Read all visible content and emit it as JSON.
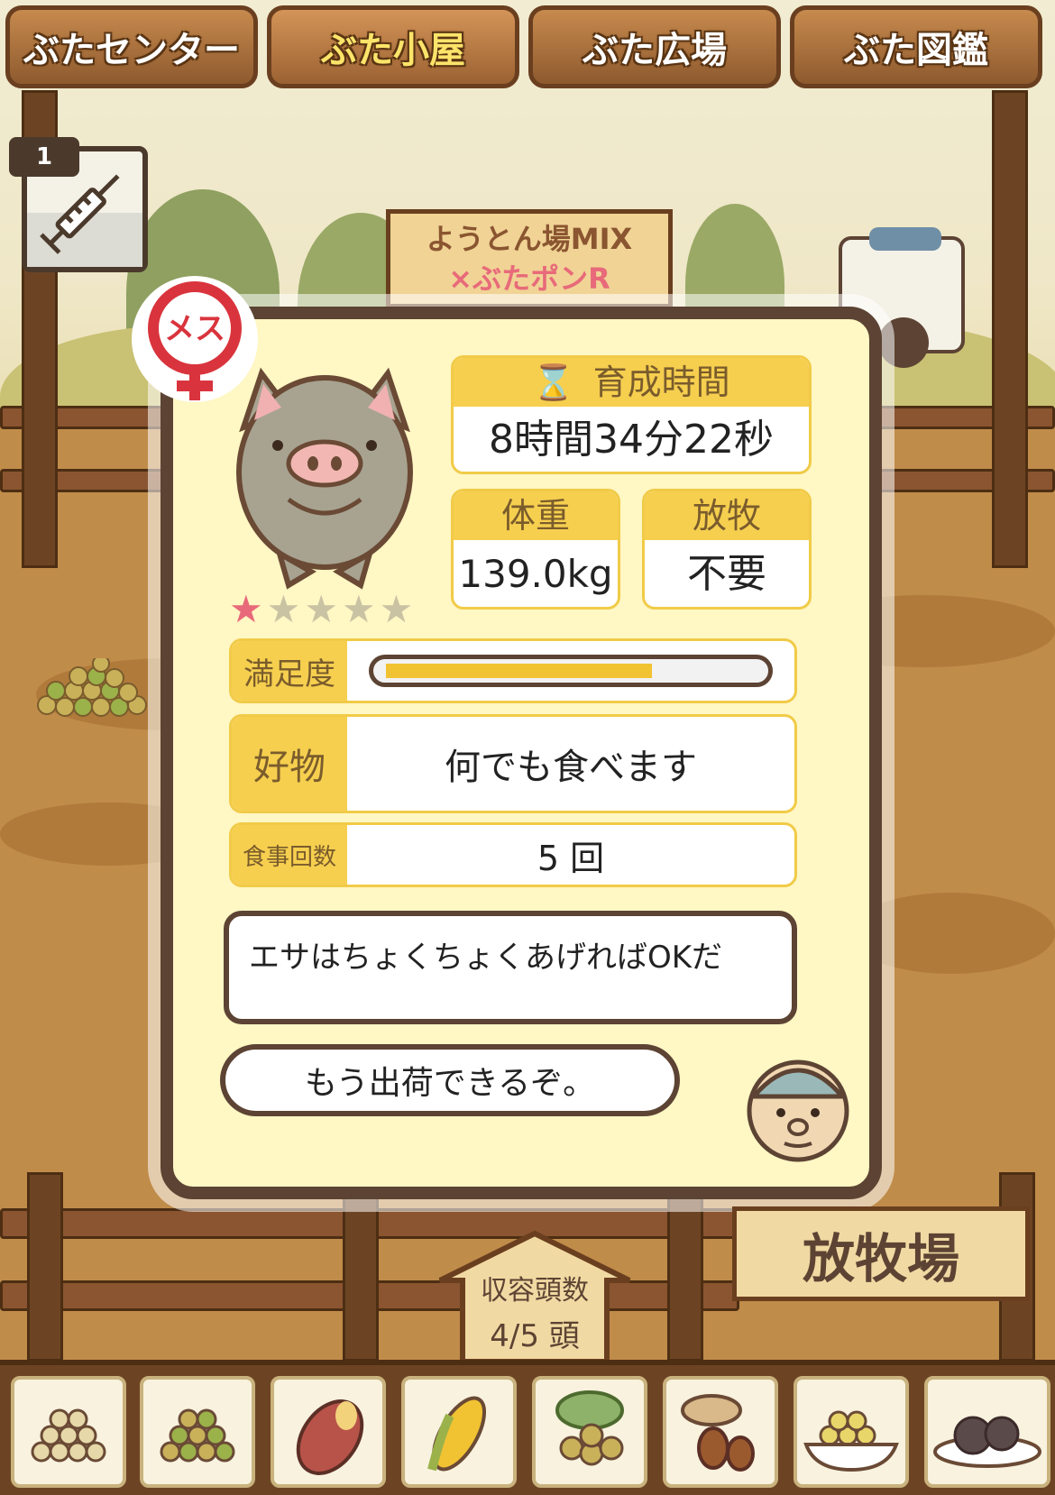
{
  "tabs": [
    {
      "label": "ぶたセンター"
    },
    {
      "label": "ぶた小屋"
    },
    {
      "label": "ぶた広場"
    },
    {
      "label": "ぶた図鑑"
    }
  ],
  "active_tab": "ぶた小屋",
  "vaccine": {
    "count": "1",
    "icon": "syringe-icon"
  },
  "top_sign": {
    "line1": "ようとん場MIX",
    "line2": "×ぶたポンR"
  },
  "pig": {
    "gender_label": "メス",
    "stars_filled": 1,
    "stars_total": 5,
    "growth_time_label": "育成時間",
    "growth_time_value": "8時間34分22秒",
    "weight_label": "体重",
    "weight_value": "139.0kg",
    "grazing_label": "放牧",
    "grazing_value": "不要",
    "satisfaction_label": "満足度",
    "satisfaction_level": 0.72,
    "favorite_label": "好物",
    "favorite_value": "何でも食べます",
    "meals_label": "食事回数",
    "meals_value": "5 回"
  },
  "farmer": {
    "speech1": "エサはちょくちょくあげればOKだ",
    "speech2": "もう出荷できるぞ。"
  },
  "capacity": {
    "label": "収容頭数",
    "value": "4/5 頭"
  },
  "pasture_sign": "放牧場",
  "feeds": [
    "grain-feed-icon",
    "mixed-grain-icon",
    "sweet-potato-icon",
    "corn-icon",
    "leaf-nut-icon",
    "acorn-icon",
    "feed-bowl-icon",
    "truffle-icon"
  ],
  "colors": {
    "accent": "#f6cf4f",
    "frame": "#5c4333",
    "panel": "#fff7c4",
    "bar": "#f1c232",
    "star": "#e86a7a"
  }
}
